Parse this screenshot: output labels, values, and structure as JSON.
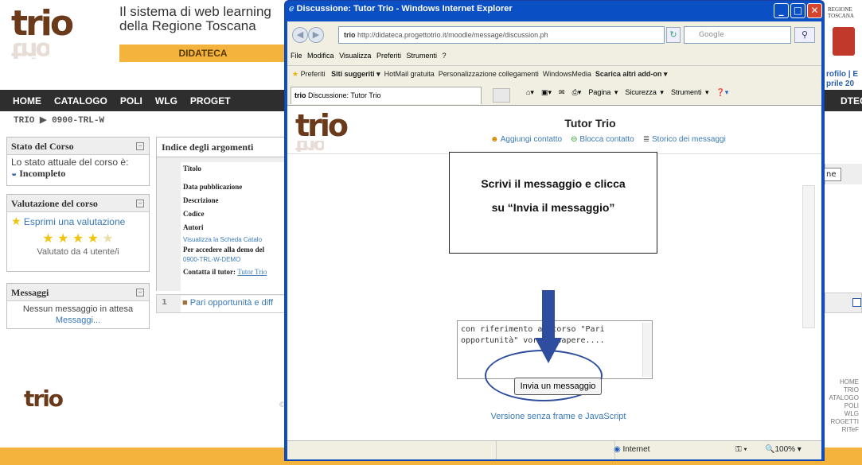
{
  "site": {
    "logo": "trio",
    "tagline_line1": "Il sistema di web learning",
    "tagline_line2": "della Regione Toscana",
    "didateca": "DIDATECA",
    "region_label1": "REGIONE",
    "region_label2": "TOSCANA",
    "right_partial1": "rofilo | E",
    "right_partial2": "prile 20",
    "right_nav_partial": "DTECA",
    "nav": [
      "HOME",
      "CATALOGO",
      "POLI",
      "WLG",
      "PROGET"
    ],
    "breadcrumb": "TRIO ▶ 0900-TRL-W",
    "stato": {
      "title": "Stato del Corso",
      "text": "Lo stato attuale del corso è:",
      "status": "Incompleto"
    },
    "valutazione": {
      "title": "Valutazione del corso",
      "link": "Esprimi una valutazione",
      "rating": 4,
      "max": 5,
      "count": "Valutato da 4 utente/i"
    },
    "messaggi": {
      "title": "Messaggi",
      "text": "Nessun messaggio in attesa",
      "link": "Messaggi..."
    },
    "indice_title": "Indice degli argomenti",
    "course_fields": [
      "Titolo",
      "Data pubblicazione",
      "Descrizione",
      "Codice",
      "Autori"
    ],
    "scheda_link": "Visualizza la Scheda Catalo",
    "demo_label": "Per accedere alla demo del",
    "demo_code": "0900-TRL-W-DEMO",
    "contatta_label": "Contatta il tutor:",
    "contatta_link": "Tutor Trio",
    "topic_num": "1",
    "topic": "Pari opportunità e diff",
    "right_btn_partial": "ne",
    "footer_links": [
      "HOME",
      "TRIO",
      "ATALOGO",
      "POLI",
      "WLG",
      "ROGETTI",
      "RITeF"
    ],
    "footer_partial": "©"
  },
  "ie": {
    "title": "Discussione: Tutor Trio - Windows Internet Explorer",
    "address": "http://didateca.progettotrio.it/moodle/message/discussion.ph",
    "address_domain": "progettotrio.it",
    "search_placeholder": "Google",
    "menu": [
      "File",
      "Modifica",
      "Visualizza",
      "Preferiti",
      "Strumenti",
      "?"
    ],
    "favorites": "Preferiti",
    "fav_items": [
      "Siti suggeriti ▾",
      "HotMail gratuita",
      "Personalizzazione collegamenti",
      "WindowsMedia",
      "Scarica altri add-on ▾"
    ],
    "tab": "Discussione: Tutor Trio",
    "tools": [
      "Pagina ▾",
      "Sicurezza ▾",
      "Strumenti ▾"
    ],
    "status_zone": "Internet",
    "zoom": "100%"
  },
  "chat": {
    "tutor": "Tutor Trio",
    "actions": [
      "Aggiungi contatto",
      "Blocca contatto",
      "Storico dei messaggi"
    ],
    "callout_line1": "Scrivi il messaggio e clicca",
    "callout_line2": "su “Invia il messaggio”",
    "message_text": "con riferimento al corso \"Pari opportunità\" vorrei sapere....",
    "send_button": "Invia un messaggio",
    "noframe_link": "Versione senza frame e JavaScript"
  },
  "colors": {
    "ie_blue": "#0a4fc4",
    "accent_orange": "#f3b33d",
    "nav_dark": "#2e2e2e",
    "link_blue": "#3a7ab8",
    "arrow_blue": "#2f4d9e"
  }
}
